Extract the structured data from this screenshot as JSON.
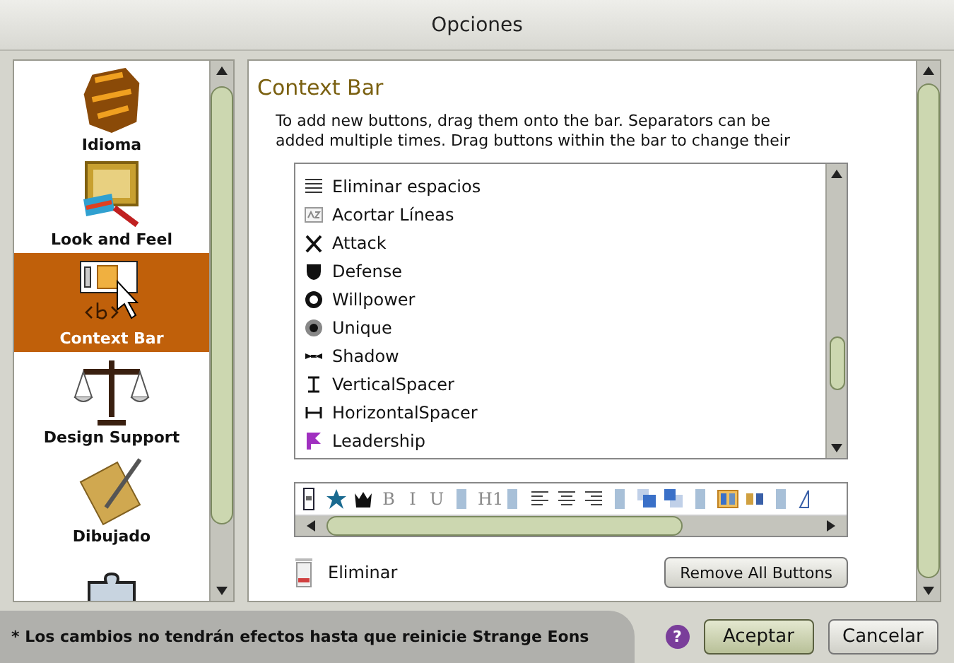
{
  "window": {
    "title": "Opciones"
  },
  "sidebar": {
    "items": [
      {
        "label": "Idioma",
        "kind": "rock",
        "selected": false
      },
      {
        "label": "Look and Feel",
        "kind": "paint",
        "selected": false
      },
      {
        "label": "Context Bar",
        "kind": "bar",
        "selected": true
      },
      {
        "label": "Design Support",
        "kind": "scale",
        "selected": false
      },
      {
        "label": "Dibujado",
        "kind": "pen",
        "selected": false
      },
      {
        "kind": "puzzle",
        "selected": false
      }
    ]
  },
  "panel": {
    "heading": "Context Bar",
    "description": "To add new buttons, drag them onto the bar. Separators can be added multiple times. Drag buttons within the bar to change their",
    "available_buttons": [
      {
        "label": "Eliminar espacios",
        "kind": "lines"
      },
      {
        "label": "Acortar Líneas",
        "kind": "az"
      },
      {
        "label": "Attack",
        "kind": "axes"
      },
      {
        "label": "Defense",
        "kind": "shield"
      },
      {
        "label": "Willpower",
        "kind": "ring"
      },
      {
        "label": "Unique",
        "kind": "dot"
      },
      {
        "label": "Shadow",
        "kind": "wings"
      },
      {
        "label": "VerticalSpacer",
        "kind": "vspace"
      },
      {
        "label": "HorizontalSpacer",
        "kind": "hspace"
      },
      {
        "label": "Leadership",
        "kind": "flag"
      }
    ],
    "bar_buttons": [
      {
        "kind": "handle"
      },
      {
        "kind": "star"
      },
      {
        "kind": "crown"
      },
      {
        "kind": "glyph",
        "label": "B"
      },
      {
        "kind": "glyph",
        "label": "I"
      },
      {
        "kind": "glyph",
        "label": "U"
      },
      {
        "kind": "separator"
      },
      {
        "kind": "glyph",
        "label": "H1"
      },
      {
        "kind": "separator"
      },
      {
        "kind": "align-left"
      },
      {
        "kind": "align-center"
      },
      {
        "kind": "align-right"
      },
      {
        "kind": "separator"
      },
      {
        "kind": "layer-front"
      },
      {
        "kind": "layer-back"
      },
      {
        "kind": "separator"
      },
      {
        "kind": "layout-a"
      },
      {
        "kind": "layout-b"
      },
      {
        "kind": "separator"
      },
      {
        "kind": "tool"
      }
    ],
    "trash_label": "Eliminar",
    "remove_button": "Remove All Buttons"
  },
  "footer": {
    "note": "* Los cambios no tendrán efectos hasta que reinicie Strange Eons",
    "help": "?",
    "buttons": [
      {
        "label": "Aceptar",
        "kind": "primary"
      },
      {
        "label": "Cancelar",
        "kind": "normal"
      }
    ]
  }
}
